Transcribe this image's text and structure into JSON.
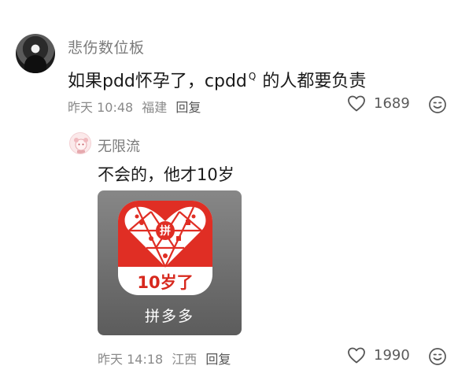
{
  "main_comment": {
    "username": "悲伤数位板",
    "text_before": "如果pdd怀孕了，cpdd",
    "superscript": "Q",
    "text_after": "的人都要负责",
    "time": "昨天 10:48",
    "location": "福建",
    "reply_label": "回复",
    "likes": "1689"
  },
  "reply_comment": {
    "username": "无限流",
    "text": "不会的，他才10岁",
    "image": {
      "app_label": "10岁了",
      "caption": "拼多多",
      "center_char": "拼"
    },
    "time": "昨天 14:18",
    "location": "江西",
    "reply_label": "回复",
    "likes": "1990"
  },
  "colors": {
    "brand_red": "#e02e24",
    "meta_gray": "#8a8a8a"
  },
  "icons": [
    "heart-icon",
    "emoji-icon"
  ]
}
